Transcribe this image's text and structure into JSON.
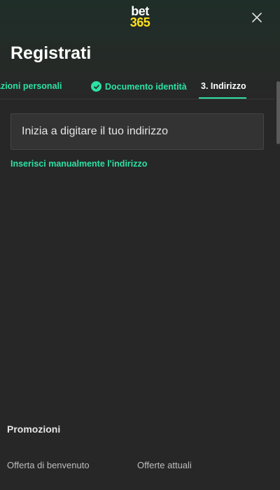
{
  "logo": {
    "line1": "bet",
    "line2": "365"
  },
  "header": {
    "title": "Registrati"
  },
  "steps": [
    {
      "label": "Informazioni personali",
      "visible_label": "azioni personali",
      "state": "done"
    },
    {
      "label": "Documento identità",
      "state": "done"
    },
    {
      "label": "3.  Indirizzo",
      "state": "current"
    }
  ],
  "address": {
    "placeholder": "Inizia a digitare il tuo indirizzo",
    "manual_link": "Inserisci manualmente l'indirizzo"
  },
  "footer": {
    "title": "Promozioni",
    "links": [
      "Offerta di benvenuto",
      "Offerte attuali"
    ]
  },
  "colors": {
    "accent": "#2de1a4",
    "brand_yellow": "#ffdf1b",
    "background": "#272727"
  },
  "icons": {
    "close": "close-icon",
    "check": "check-icon"
  }
}
